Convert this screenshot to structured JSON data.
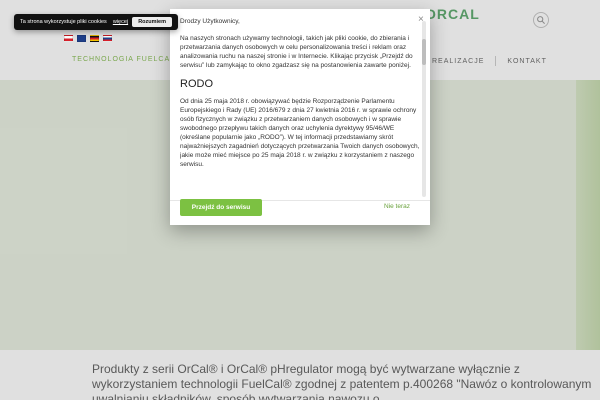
{
  "cookie": {
    "message": "Ta strona wykorzystuje pliki cookies",
    "more": "więcej",
    "accept": "Rozumiem"
  },
  "header": {
    "logo": "ORCAL"
  },
  "nav": {
    "left_label": "TECHNOLOGIA FUELCAL",
    "right_items": [
      "REALIZACJE",
      "KONTAKT"
    ]
  },
  "modal": {
    "greeting": "Drodzy Użytkownicy,",
    "p1": "Na naszych stronach używamy technologii, takich jak pliki cookie, do zbierania i przetwarzania danych osobowych w celu personalizowania treści i reklam oraz analizowania ruchu na naszej stronie i w Internecie. Klikając przycisk „Przejdź do serwisu” lub zamykając to okno zgadzasz się na postanowienia zawarte poniżej.",
    "heading": "RODO",
    "p2": "Od dnia 25 maja 2018 r. obowiązywać będzie Rozporządzenie Parlamentu Europejskiego i Rady (UE) 2016/679 z dnia 27 kwietnia 2016 r. w sprawie ochrony osób fizycznych w związku z przetwarzaniem danych osobowych i w sprawie swobodnego przepływu takich danych oraz uchylenia dyrektywy 95/46/WE (określane popularnie jako „RODO”). W tej informacji przedstawiamy skrót najważniejszych zagadnień dotyczących przetwarzania Twoich danych osobowych, jakie może mieć miejsce po 25 maja 2018 r. w związku z korzystaniem z naszego serwisu.",
    "primary_button": "Przejdź do serwisu",
    "secondary_link": "Nie teraz",
    "close_symbol": "×"
  },
  "content": {
    "paragraph": "Produkty z serii OrCal® i OrCal® pHregulator mogą być wytwarzane wyłącznie z wykorzystaniem technologii FuelCal® zgodnej z patentem p.400268 \"Nawóz o kontrolowanym uwalnianiu składników, sposób wytwarzania nawozu o"
  },
  "colors": {
    "accent_green": "#7cc142",
    "nav_green": "#8cbf5a",
    "cookie_bar": "#111111"
  }
}
